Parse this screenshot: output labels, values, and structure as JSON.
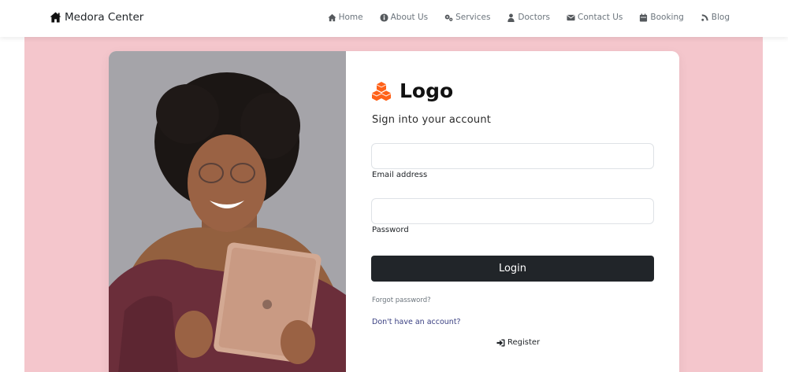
{
  "navbar": {
    "brand": "Medora Center",
    "brand_icon": "house-icon",
    "links": [
      {
        "label": "Home",
        "icon": "home-icon"
      },
      {
        "label": "About Us",
        "icon": "info-circle-icon"
      },
      {
        "label": "Services",
        "icon": "gears-icon"
      },
      {
        "label": "Doctors",
        "icon": "user-doctor-icon"
      },
      {
        "label": "Contact Us",
        "icon": "envelope-icon"
      },
      {
        "label": "Booking",
        "icon": "calendar-icon"
      },
      {
        "label": "Blog",
        "icon": "blog-icon"
      }
    ]
  },
  "login": {
    "logo_text": "Logo",
    "logo_icon": "cubes-icon",
    "logo_color": "#ff6219",
    "subtitle": "Sign into your account",
    "email_value": "",
    "email_label": "Email address",
    "password_value": "",
    "password_label": "Password",
    "login_button": "Login",
    "forgot_password": "Forgot password?",
    "no_account": "Don't have an account?",
    "register_label": "Register",
    "register_icon": "sign-in-icon"
  },
  "colors": {
    "background_pink": "#f4c6cc",
    "button_dark": "#212529",
    "link_blue": "#393f81"
  }
}
